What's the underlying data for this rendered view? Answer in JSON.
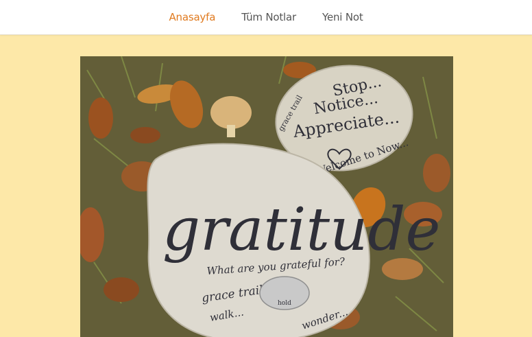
{
  "nav": {
    "items": [
      {
        "label": "Anasayfa",
        "active": true
      },
      {
        "label": "Tüm Notlar",
        "active": false
      },
      {
        "label": "Yeni Not",
        "active": false
      }
    ],
    "active_color": "#e07a1f",
    "text_color": "#555555"
  },
  "page": {
    "background_color": "#fde8a8"
  },
  "hero_image": {
    "small_stone": {
      "line1": "Stop...",
      "line2": "Notice...",
      "line3": "Appreciate...",
      "line4": "Welcome to Now...",
      "side": "grace trail"
    },
    "large_stone": {
      "word": "gratitude",
      "question": "What are you grateful for?",
      "footer1": "grace trail",
      "footer2": "walk...",
      "footer3": "wonder...",
      "badge": "hold"
    }
  }
}
